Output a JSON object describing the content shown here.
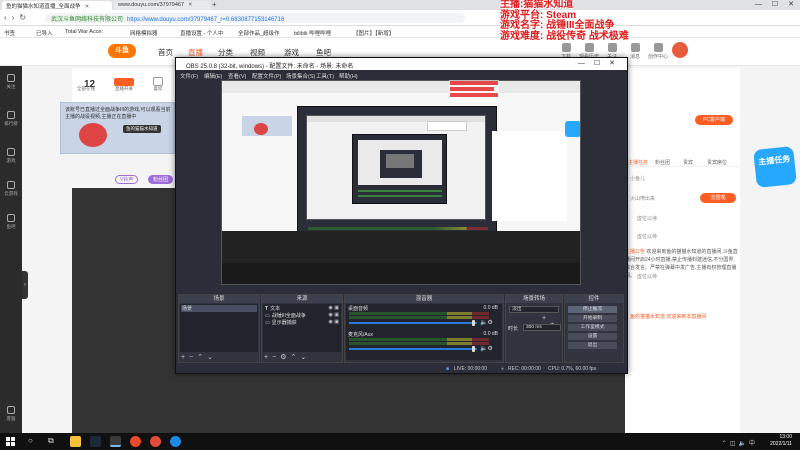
{
  "browser": {
    "tabs": [
      {
        "label": "鱼的猫猫水知道直播_全面战争"
      },
      {
        "label": "www.douyu.com/37979467"
      }
    ],
    "url_host": "武汉斗鱼网络科技有限公司",
    "url": "https://www.douyu.com/37979467_r=0.6830877153146716",
    "bookmarks": [
      "书签",
      "已导入",
      "Total War Acce:",
      "网格模拟器",
      "直播设置 - 个人中",
      "全部作品_超级作",
      "bilibili 哔哩哔哩",
      "【图片】【新增】"
    ]
  },
  "site": {
    "logo": "斗鱼",
    "nav": [
      "首页",
      "直播",
      "分类",
      "视频",
      "游戏",
      "鱼吧"
    ],
    "header_icons": [
      "下载",
      "观看历史",
      "关注",
      "消息",
      "创作中心"
    ]
  },
  "overlay": {
    "lines": [
      "主播:猫猫水知道",
      "游戏平台: Steam",
      "游戏名字: 战锤III全面战争",
      "游戏难度: 战役传奇 战术极难"
    ]
  },
  "left_rail": [
    "关注",
    "排行榜",
    "游戏",
    "云游戏",
    "鱼吧",
    "客服"
  ],
  "room": {
    "stats": [
      {
        "value": "12",
        "label": "全部在线"
      },
      {
        "label": "直播开关"
      },
      {
        "label": "喜欢"
      }
    ],
    "banner_text": "该账号已直播过全面战争III的游戏,可以观看当前主播的战役视频,主播正在直播中",
    "banner_chip": "鱼的猫猫水知道",
    "tags": [
      "V铃声",
      "粉丝团"
    ]
  },
  "side_panel": {
    "pc_button": "PC客户端",
    "tabs": [
      "主播任务",
      "粉丝团",
      "贵宾",
      "贵宾席位"
    ],
    "gift_button": "去围观",
    "messages": [
      "小鱼儿",
      "火山喷出来",
      "虚位以待",
      "虚位以待",
      "虚位以待"
    ],
    "notice_label": "主播公告",
    "notice": "欢迎来到鱼的猫猫水知道的直播间,斗鱼直播间开启24小时直播,禁止传播封建迷信,不分国界,综合发言。严禁在弹幕中发广告,主播有权管理直播间。",
    "chat_hint": "鱼的猫猫水知道  欢迎来到本直播间",
    "task_badge": "主播任务"
  },
  "obs": {
    "title": "OBS 25.0.8 (32-bit, windows) - 配置文件: 未命名 - 场景: 未命名",
    "menu": [
      "文件(F)",
      "编辑(E)",
      "查看(V)",
      "配置文件(P)",
      "场景集合(S)",
      "工具(T)",
      "帮助(H)"
    ],
    "docks": {
      "scenes": {
        "title": "场景",
        "items": [
          "场景"
        ]
      },
      "sources": {
        "title": "来源",
        "items": [
          "文本",
          "战锤III全面战争",
          "显示器捕获"
        ]
      },
      "mixer": {
        "title": "混音器",
        "tracks": [
          {
            "name": "桌面音频",
            "db": "0.0 dB"
          },
          {
            "name": "麦克风/Aux",
            "db": "0.0 dB"
          }
        ]
      },
      "transitions": {
        "title": "场景转场",
        "mode": "淡出",
        "duration_label": "时长",
        "duration": "300 ms"
      },
      "controls": {
        "title": "控件",
        "buttons": [
          "停止推流",
          "开始录制",
          "工作室模式",
          "设置",
          "退出"
        ]
      }
    },
    "status": {
      "live": "LIVE: 00:00:00",
      "rec": "REC: 00:00:00",
      "cpu": "CPU: 0.7%, 60.00 fps"
    }
  },
  "taskbar": {
    "time": "13:00",
    "date": "2022/1/11",
    "apps": [
      {
        "name": "file-explorer-icon",
        "color": "#f3c13a"
      },
      {
        "name": "steam-icon",
        "color": "#1b2838"
      },
      {
        "name": "obs-icon",
        "color": "#3a3a3a"
      },
      {
        "name": "douyu-icon",
        "color": "#e94a2b"
      },
      {
        "name": "browser-icon",
        "color": "#e24b3b"
      },
      {
        "name": "edge-icon",
        "color": "#1e88e5"
      }
    ]
  }
}
